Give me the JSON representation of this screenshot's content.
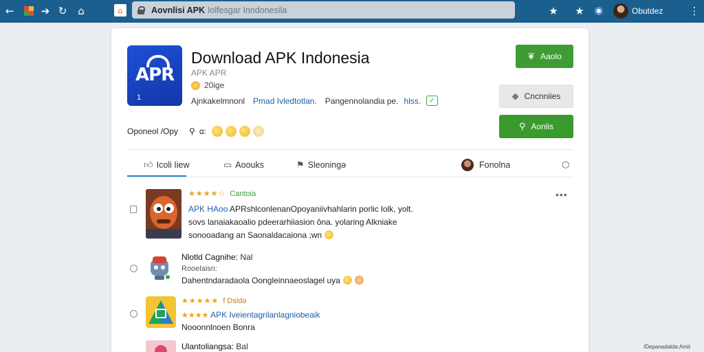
{
  "browser": {
    "url_domain": "Aovnlisi APK",
    "url_rest": "Iolfesgar Inndonesila",
    "profile_name": "Obutdez",
    "icons": [
      "back-arrow",
      "extension",
      "forward-arrow",
      "reload",
      "home",
      "bookmark-star",
      "star",
      "profile-circle",
      "menu-kebab"
    ]
  },
  "app": {
    "title": "Download APK Indonesia",
    "icon_text": "APR",
    "icon_badge": "1",
    "subtitle": "APK APR",
    "rating_count": "20ige",
    "meta": [
      "Ajnkakelmnonl",
      "Pmad Ivledtotlan.",
      "Pangennolandia pe.",
      "hlss."
    ],
    "opinion_label": "Oponeol /Opy",
    "opinion_count": "ɑ:"
  },
  "buttons": {
    "install": "Aaolo",
    "share": "Cncnniies",
    "download": "Aonlis"
  },
  "tabs": [
    {
      "label": "Icoli Iiew",
      "icon": "thumbs-up-icon"
    },
    {
      "label": "Aoouks",
      "icon": "comment-icon"
    },
    {
      "label": "Sleoningə",
      "icon": "flag-icon"
    },
    {
      "label": "Fonolna",
      "icon": "avatar"
    }
  ],
  "reviews": [
    {
      "stars": "★★★★☆",
      "star_label": "Cantoia",
      "line1_link": "APK HAoo",
      "line1_text": "APRshlconlenanOpoyaniivhahlarin porlic lolk, yolt.",
      "line2": "sovs lanaiakaoalio pdeerarhiiasion ôna. yolaring Alkniake",
      "line3": "sonooadang an Saonaldacaiona ;wn"
    },
    {
      "title": "Nlotld Cagnihe:",
      "title_b": "Nal",
      "sub": "Rooelaisn:",
      "line": "Dahentndaradaola Oongleinnaeoslagel uya"
    },
    {
      "stars": "★★★★★",
      "star_label": "f Dsldə",
      "line1_stars": "★★★★",
      "line1_link": "APK Iveientagrilanlagniobeaik",
      "line2": "Nooonnlnoen Bonra"
    },
    {
      "title": "Ulantoliangsa:",
      "title_b": "Bal"
    }
  ],
  "corner_text": "/Depanadalda:Amit",
  "colors": {
    "topbar": "#1a5f8e",
    "install_green": "#3f9c35",
    "link_blue": "#1d5ea8",
    "tab_accent": "#2c7ec9"
  }
}
